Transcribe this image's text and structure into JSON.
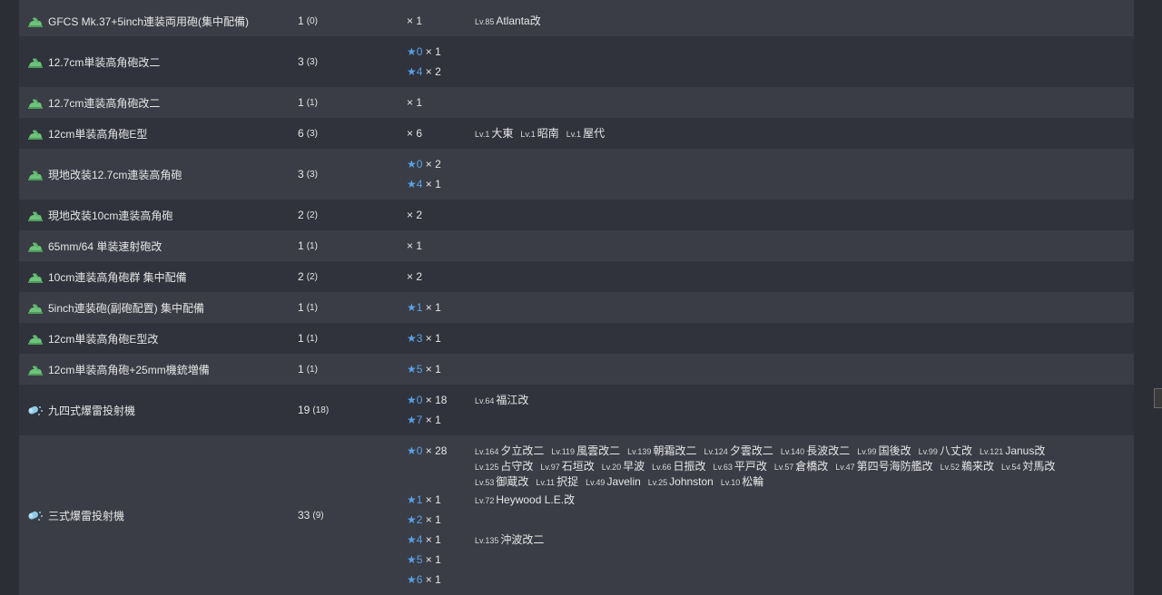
{
  "rows": [
    {
      "name": "GFCS Mk.37+5inch連装両用砲(集中配備)",
      "icon": "gun-icon",
      "count": "1",
      "sub": "(0)",
      "groups": [
        {
          "star": "",
          "qty": "× 1",
          "ships": [
            {
              "lv": "Lv.85",
              "ship": "Atlanta改"
            }
          ]
        }
      ]
    },
    {
      "name": "12.7cm単装高角砲改二",
      "icon": "gun-icon",
      "count": "3",
      "sub": "(3)",
      "groups": [
        {
          "star": "★0",
          "qty": "× 1",
          "ships": []
        },
        {
          "star": "★4",
          "qty": "× 2",
          "ships": []
        }
      ]
    },
    {
      "name": "12.7cm連装高角砲改二",
      "icon": "gun-icon",
      "count": "1",
      "sub": "(1)",
      "groups": [
        {
          "star": "",
          "qty": "× 1",
          "ships": []
        }
      ]
    },
    {
      "name": "12cm単装高角砲E型",
      "icon": "gun-icon",
      "count": "6",
      "sub": "(3)",
      "groups": [
        {
          "star": "",
          "qty": "× 6",
          "ships": [
            {
              "lv": "Lv.1",
              "ship": "大東"
            },
            {
              "lv": "Lv.1",
              "ship": "昭南"
            },
            {
              "lv": "Lv.1",
              "ship": "屋代"
            }
          ]
        }
      ]
    },
    {
      "name": "現地改装12.7cm連装高角砲",
      "icon": "gun-icon",
      "count": "3",
      "sub": "(3)",
      "groups": [
        {
          "star": "★0",
          "qty": "× 2",
          "ships": []
        },
        {
          "star": "★4",
          "qty": "× 1",
          "ships": []
        }
      ]
    },
    {
      "name": "現地改装10cm連装高角砲",
      "icon": "gun-icon",
      "count": "2",
      "sub": "(2)",
      "groups": [
        {
          "star": "",
          "qty": "× 2",
          "ships": []
        }
      ]
    },
    {
      "name": "65mm/64 単装速射砲改",
      "icon": "gun-icon",
      "count": "1",
      "sub": "(1)",
      "groups": [
        {
          "star": "",
          "qty": "× 1",
          "ships": []
        }
      ]
    },
    {
      "name": "10cm連装高角砲群 集中配備",
      "icon": "gun-icon",
      "count": "2",
      "sub": "(2)",
      "groups": [
        {
          "star": "",
          "qty": "× 2",
          "ships": []
        }
      ]
    },
    {
      "name": "5inch連装砲(副砲配置) 集中配備",
      "icon": "gun-icon",
      "count": "1",
      "sub": "(1)",
      "groups": [
        {
          "star": "★1",
          "qty": "× 1",
          "ships": []
        }
      ]
    },
    {
      "name": "12cm単装高角砲E型改",
      "icon": "gun-icon",
      "count": "1",
      "sub": "(1)",
      "groups": [
        {
          "star": "★3",
          "qty": "× 1",
          "ships": []
        }
      ]
    },
    {
      "name": "12cm単装高角砲+25mm機銃増備",
      "icon": "gun-icon",
      "count": "1",
      "sub": "(1)",
      "groups": [
        {
          "star": "★5",
          "qty": "× 1",
          "ships": []
        }
      ]
    },
    {
      "name": "九四式爆雷投射機",
      "icon": "depth-charge-icon",
      "count": "19",
      "sub": "(18)",
      "groups": [
        {
          "star": "★0",
          "qty": "× 18",
          "ships": [
            {
              "lv": "Lv.64",
              "ship": "福江改"
            }
          ]
        },
        {
          "star": "★7",
          "qty": "× 1",
          "ships": []
        }
      ]
    },
    {
      "name": "三式爆雷投射機",
      "icon": "depth-charge-icon",
      "count": "33",
      "sub": "(9)",
      "groups": [
        {
          "star": "★0",
          "qty": "× 28",
          "ships": [
            {
              "lv": "Lv.164",
              "ship": "夕立改二"
            },
            {
              "lv": "Lv.119",
              "ship": "風雲改二"
            },
            {
              "lv": "Lv.139",
              "ship": "朝霜改二"
            },
            {
              "lv": "Lv.124",
              "ship": "夕雲改二"
            },
            {
              "lv": "Lv.140",
              "ship": "長波改二"
            },
            {
              "lv": "Lv.99",
              "ship": "国後改"
            },
            {
              "lv": "Lv.99",
              "ship": "八丈改"
            },
            {
              "lv": "Lv.121",
              "ship": "Janus改"
            },
            {
              "lv": "Lv.125",
              "ship": "占守改"
            },
            {
              "lv": "Lv.97",
              "ship": "石垣改"
            },
            {
              "lv": "Lv.20",
              "ship": "早波"
            },
            {
              "lv": "Lv.66",
              "ship": "日振改"
            },
            {
              "lv": "Lv.63",
              "ship": "平戸改"
            },
            {
              "lv": "Lv.57",
              "ship": "倉橋改"
            },
            {
              "lv": "Lv.47",
              "ship": "第四号海防艦改"
            },
            {
              "lv": "Lv.52",
              "ship": "鵜来改"
            },
            {
              "lv": "Lv.54",
              "ship": "対馬改"
            },
            {
              "lv": "Lv.53",
              "ship": "御蔵改"
            },
            {
              "lv": "Lv.11",
              "ship": "択捉"
            },
            {
              "lv": "Lv.49",
              "ship": "Javelin"
            },
            {
              "lv": "Lv.25",
              "ship": "Johnston"
            },
            {
              "lv": "Lv.10",
              "ship": "松輪"
            }
          ]
        },
        {
          "star": "★1",
          "qty": "× 1",
          "ships": [
            {
              "lv": "Lv.72",
              "ship": "Heywood L.E.改"
            }
          ]
        },
        {
          "star": "★2",
          "qty": "× 1",
          "ships": []
        },
        {
          "star": "★4",
          "qty": "× 1",
          "ships": [
            {
              "lv": "Lv.135",
              "ship": "沖波改二"
            }
          ]
        },
        {
          "star": "★5",
          "qty": "× 1",
          "ships": []
        },
        {
          "star": "★6",
          "qty": "× 1",
          "ships": []
        }
      ]
    }
  ],
  "colors": {
    "star": "#5aa0e8",
    "gun_icon": "#6cc47a",
    "depth_charge_icon": "#8ec9e6"
  }
}
